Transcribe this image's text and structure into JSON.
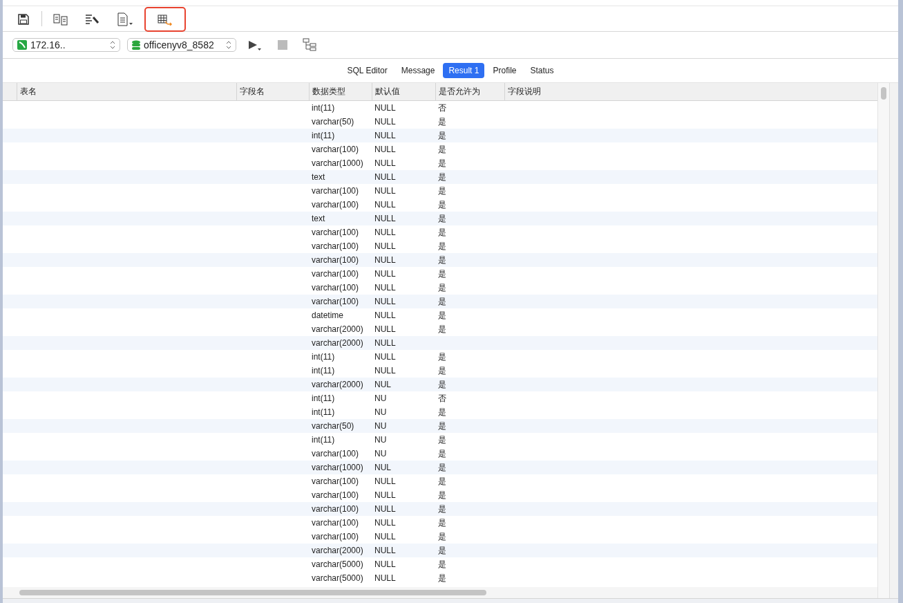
{
  "toolbar": {
    "buttons": [
      {
        "kind": "save",
        "highlighted": false
      },
      {
        "kind": "compare",
        "highlighted": false
      },
      {
        "kind": "format",
        "highlighted": false
      },
      {
        "kind": "document",
        "highlighted": false
      },
      {
        "kind": "export",
        "highlighted": true
      }
    ]
  },
  "connection_bar": {
    "connection": "172.16..",
    "database": "officenyv8_8582"
  },
  "tabs": [
    {
      "label": "SQL Editor",
      "selected": false
    },
    {
      "label": "Message",
      "selected": false
    },
    {
      "label": "Result 1",
      "selected": true
    },
    {
      "label": "Profile",
      "selected": false
    },
    {
      "label": "Status",
      "selected": false
    }
  ],
  "table": {
    "columns": [
      "表名",
      "字段名",
      "数据类型",
      "默认值",
      "是否允许为",
      "字段说明"
    ],
    "rows": [
      {
        "data_type": "int(11)",
        "default": "NULL",
        "nullable": "否"
      },
      {
        "data_type": "varchar(50)",
        "default": "NULL",
        "nullable": "是"
      },
      {
        "data_type": "int(11)",
        "default": "NULL",
        "nullable": "是"
      },
      {
        "data_type": "varchar(100)",
        "default": "NULL",
        "nullable": "是"
      },
      {
        "data_type": "varchar(1000)",
        "default": "NULL",
        "nullable": "是"
      },
      {
        "data_type": "text",
        "default": "NULL",
        "nullable": "是"
      },
      {
        "data_type": "varchar(100)",
        "default": "NULL",
        "nullable": "是"
      },
      {
        "data_type": "varchar(100)",
        "default": "NULL",
        "nullable": "是"
      },
      {
        "data_type": "text",
        "default": "NULL",
        "nullable": "是"
      },
      {
        "data_type": "varchar(100)",
        "default": "NULL",
        "nullable": "是"
      },
      {
        "data_type": "varchar(100)",
        "default": "NULL",
        "nullable": "是"
      },
      {
        "data_type": "varchar(100)",
        "default": "NULL",
        "nullable": "是"
      },
      {
        "data_type": "varchar(100)",
        "default": "NULL",
        "nullable": "是"
      },
      {
        "data_type": "varchar(100)",
        "default": "NULL",
        "nullable": "是"
      },
      {
        "data_type": "varchar(100)",
        "default": "NULL",
        "nullable": "是"
      },
      {
        "data_type": "datetime",
        "default": "NULL",
        "nullable": "是"
      },
      {
        "data_type": "varchar(2000)",
        "default": "NULL",
        "nullable": "是"
      },
      {
        "data_type": "varchar(2000)",
        "default": "NULL"
      },
      {
        "data_type": "int(11)",
        "default": "NULL",
        "nullable": "是"
      },
      {
        "data_type": "int(11)",
        "default": "NULL",
        "nullable": "是"
      },
      {
        "data_type": "varchar(2000)",
        "default": "NUL",
        "nullable": "是"
      },
      {
        "data_type": "int(11)",
        "default": "NU",
        "nullable": "否"
      },
      {
        "data_type": "int(11)",
        "default": "NU",
        "nullable": "是"
      },
      {
        "data_type": "varchar(50)",
        "default": "NU",
        "nullable": "是"
      },
      {
        "data_type": "int(11)",
        "default": "NU",
        "nullable": "是"
      },
      {
        "data_type": "varchar(100)",
        "default": "NU",
        "nullable": "是"
      },
      {
        "data_type": "varchar(1000)",
        "default": "NUL",
        "nullable": "是"
      },
      {
        "data_type": "varchar(100)",
        "default": "NULL",
        "nullable": "是"
      },
      {
        "data_type": "varchar(100)",
        "default": "NULL",
        "nullable": "是"
      },
      {
        "data_type": "varchar(100)",
        "default": "NULL",
        "nullable": "是"
      },
      {
        "data_type": "varchar(100)",
        "default": "NULL",
        "nullable": "是"
      },
      {
        "data_type": "varchar(100)",
        "default": "NULL",
        "nullable": "是"
      },
      {
        "data_type": "varchar(2000)",
        "default": "NULL",
        "nullable": "是"
      },
      {
        "data_type": "varchar(5000)",
        "default": "NULL",
        "nullable": "是"
      },
      {
        "data_type": "varchar(5000)",
        "default": "NULL",
        "nullable": "是"
      }
    ]
  }
}
